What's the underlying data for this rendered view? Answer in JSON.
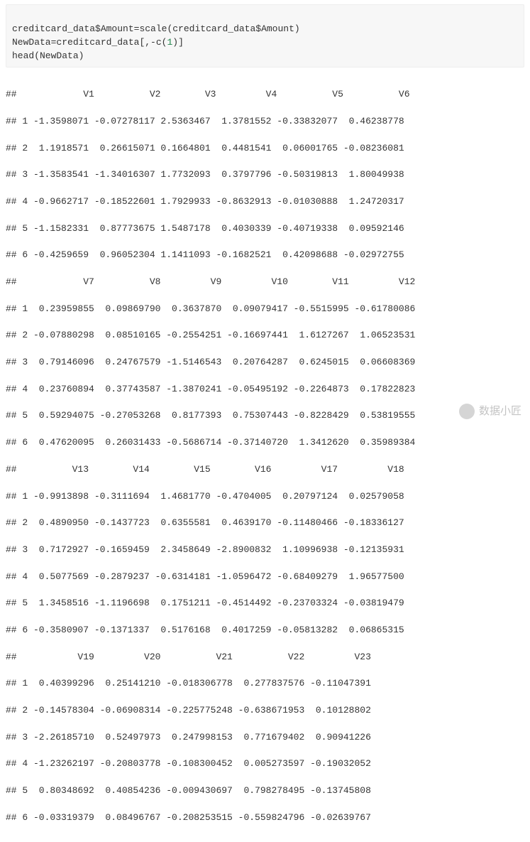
{
  "code": {
    "line1_a": "creditcard_data$Amount",
    "line1_op": "=",
    "line1_b": "scale(creditcard_data$Amount)",
    "line2_a": "NewData",
    "line2_op": "=",
    "line2_b_pre": "creditcard_data[,-c(",
    "line2_num": "1",
    "line2_b_post": ")]",
    "line3": "head(NewData)"
  },
  "output": {
    "header1": "##            V1          V2        V3         V4          V5          V6",
    "h1_rows": [
      "## 1 -1.3598071 -0.07278117 2.5363467  1.3781552 -0.33832077  0.46238778",
      "## 2  1.1918571  0.26615071 0.1664801  0.4481541  0.06001765 -0.08236081",
      "## 3 -1.3583541 -1.34016307 1.7732093  0.3797796 -0.50319813  1.80049938",
      "## 4 -0.9662717 -0.18522601 1.7929933 -0.8632913 -0.01030888  1.24720317",
      "## 5 -1.1582331  0.87773675 1.5487178  0.4030339 -0.40719338  0.09592146",
      "## 6 -0.4259659  0.96052304 1.1411093 -0.1682521  0.42098688 -0.02972755"
    ],
    "header2": "##            V7          V8         V9         V10        V11         V12",
    "h2_rows": [
      "## 1  0.23959855  0.09869790  0.3637870  0.09079417 -0.5515995 -0.61780086",
      "## 2 -0.07880298  0.08510165 -0.2554251 -0.16697441  1.6127267  1.06523531",
      "## 3  0.79146096  0.24767579 -1.5146543  0.20764287  0.6245015  0.06608369",
      "## 4  0.23760894  0.37743587 -1.3870241 -0.05495192 -0.2264873  0.17822823",
      "## 5  0.59294075 -0.27053268  0.8177393  0.75307443 -0.8228429  0.53819555",
      "## 6  0.47620095  0.26031433 -0.5686714 -0.37140720  1.3412620  0.35989384"
    ],
    "header3": "##          V13        V14        V15        V16         V17         V18",
    "h3_rows": [
      "## 1 -0.9913898 -0.3111694  1.4681770 -0.4704005  0.20797124  0.02579058",
      "## 2  0.4890950 -0.1437723  0.6355581  0.4639170 -0.11480466 -0.18336127",
      "## 3  0.7172927 -0.1659459  2.3458649 -2.8900832  1.10996938 -0.12135931",
      "## 4  0.5077569 -0.2879237 -0.6314181 -1.0596472 -0.68409279  1.96577500",
      "## 5  1.3458516 -1.1196698  0.1751211 -0.4514492 -0.23703324 -0.03819479",
      "## 6 -0.3580907 -0.1371337  0.5176168  0.4017259 -0.05813282  0.06865315"
    ],
    "header4": "##           V19         V20          V21          V22         V23",
    "h4_rows": [
      "## 1  0.40399296  0.25141210 -0.018306778  0.277837576 -0.11047391",
      "## 2 -0.14578304 -0.06908314 -0.225775248 -0.638671953  0.10128802",
      "## 3 -2.26185710  0.52497973  0.247998153  0.771679402  0.90941226",
      "## 4 -1.23262197 -0.20803778 -0.108300452  0.005273597 -0.19032052",
      "## 5  0.80348692  0.40854236 -0.009430697  0.798278495 -0.13745808",
      "## 6 -0.03319379  0.08496767 -0.208253515 -0.559824796 -0.02639767"
    ]
  },
  "watermark": {
    "icon": "wechat-icon",
    "text": "数据小匠"
  },
  "chart_data": {
    "type": "table",
    "title": "head(NewData)",
    "columns": [
      "V1",
      "V2",
      "V3",
      "V4",
      "V5",
      "V6",
      "V7",
      "V8",
      "V9",
      "V10",
      "V11",
      "V12",
      "V13",
      "V14",
      "V15",
      "V16",
      "V17",
      "V18",
      "V19",
      "V20",
      "V21",
      "V22",
      "V23"
    ],
    "rows": {
      "1": [
        -1.3598071,
        -0.07278117,
        2.5363467,
        1.3781552,
        -0.33832077,
        0.46238778,
        0.23959855,
        0.0986979,
        0.363787,
        0.09079417,
        -0.5515995,
        -0.61780086,
        -0.9913898,
        -0.3111694,
        1.468177,
        -0.4704005,
        0.20797124,
        0.02579058,
        0.40399296,
        0.2514121,
        -0.018306778,
        0.277837576,
        -0.11047391
      ],
      "2": [
        1.1918571,
        0.26615071,
        0.1664801,
        0.4481541,
        0.06001765,
        -0.08236081,
        -0.07880298,
        0.08510165,
        -0.2554251,
        -0.16697441,
        1.6127267,
        1.06523531,
        0.489095,
        -0.1437723,
        0.6355581,
        0.463917,
        -0.11480466,
        -0.18336127,
        -0.14578304,
        -0.06908314,
        -0.225775248,
        -0.638671953,
        0.10128802
      ],
      "3": [
        -1.3583541,
        -1.34016307,
        1.7732093,
        0.3797796,
        -0.50319813,
        1.80049938,
        0.79146096,
        0.24767579,
        -1.5146543,
        0.20764287,
        0.6245015,
        0.06608369,
        0.7172927,
        -0.1659459,
        2.3458649,
        -2.8900832,
        1.10996938,
        -0.12135931,
        -2.2618571,
        0.52497973,
        0.247998153,
        0.771679402,
        0.90941226
      ],
      "4": [
        -0.9662717,
        -0.18522601,
        1.7929933,
        -0.8632913,
        -0.01030888,
        1.24720317,
        0.23760894,
        0.37743587,
        -1.3870241,
        -0.05495192,
        -0.2264873,
        0.17822823,
        0.5077569,
        -0.2879237,
        -0.6314181,
        -1.0596472,
        -0.68409279,
        1.965775,
        -1.23262197,
        -0.20803778,
        -0.108300452,
        0.005273597,
        -0.19032052
      ],
      "5": [
        -1.1582331,
        0.87773675,
        1.5487178,
        0.4030339,
        -0.40719338,
        0.09592146,
        0.59294075,
        -0.27053268,
        0.8177393,
        0.75307443,
        -0.8228429,
        0.53819555,
        1.3458516,
        -1.1196698,
        0.1751211,
        -0.4514492,
        -0.23703324,
        -0.03819479,
        0.80348692,
        0.40854236,
        -0.009430697,
        0.798278495,
        -0.13745808
      ],
      "6": [
        -0.4259659,
        0.96052304,
        1.1411093,
        -0.1682521,
        0.42098688,
        -0.02972755,
        0.47620095,
        0.26031433,
        -0.5686714,
        -0.3714072,
        1.341262,
        0.35989384,
        -0.3580907,
        -0.1371337,
        0.5176168,
        0.4017259,
        -0.05813282,
        0.06865315,
        -0.03319379,
        0.08496767,
        -0.208253515,
        -0.559824796,
        -0.02639767
      ]
    }
  }
}
